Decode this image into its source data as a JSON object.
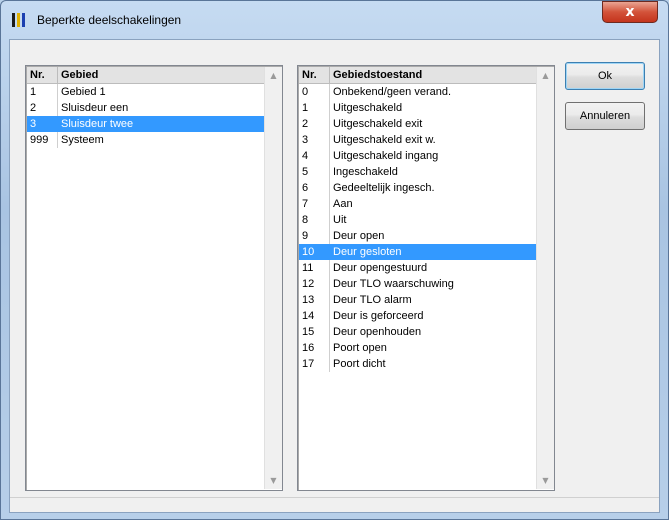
{
  "window": {
    "title": "Beperkte deelschakelingen",
    "close_label": "x"
  },
  "left_list": {
    "headers": [
      "Nr.",
      "Gebied"
    ],
    "rows": [
      [
        "1",
        "Gebied 1"
      ],
      [
        "2",
        "Sluisdeur een"
      ],
      [
        "3",
        "Sluisdeur twee"
      ],
      [
        "999",
        "Systeem"
      ]
    ],
    "selected_index": 2
  },
  "right_list": {
    "headers": [
      "Nr.",
      "Gebiedstoestand"
    ],
    "rows": [
      [
        "0",
        "Onbekend/geen verand."
      ],
      [
        "1",
        "Uitgeschakeld"
      ],
      [
        "2",
        "Uitgeschakeld exit"
      ],
      [
        "3",
        "Uitgeschakeld exit w."
      ],
      [
        "4",
        "Uitgeschakeld ingang"
      ],
      [
        "5",
        "Ingeschakeld"
      ],
      [
        "6",
        "Gedeeltelijk ingesch."
      ],
      [
        "7",
        "Aan"
      ],
      [
        "8",
        "Uit"
      ],
      [
        "9",
        "Deur open"
      ],
      [
        "10",
        "Deur gesloten"
      ],
      [
        "11",
        "Deur opengestuurd"
      ],
      [
        "12",
        "Deur TLO waarschuwing"
      ],
      [
        "13",
        "Deur TLO alarm"
      ],
      [
        "14",
        "Deur is geforceerd"
      ],
      [
        "15",
        "Deur openhouden"
      ],
      [
        "16",
        "Poort open"
      ],
      [
        "17",
        "Poort dicht"
      ]
    ],
    "selected_index": 10
  },
  "buttons": {
    "ok_label": "Ok",
    "cancel_label": "Annuleren"
  },
  "colors": {
    "selection": "#3399ff",
    "title_bar": "#b9d1ea",
    "close_button": "#c4341c"
  }
}
